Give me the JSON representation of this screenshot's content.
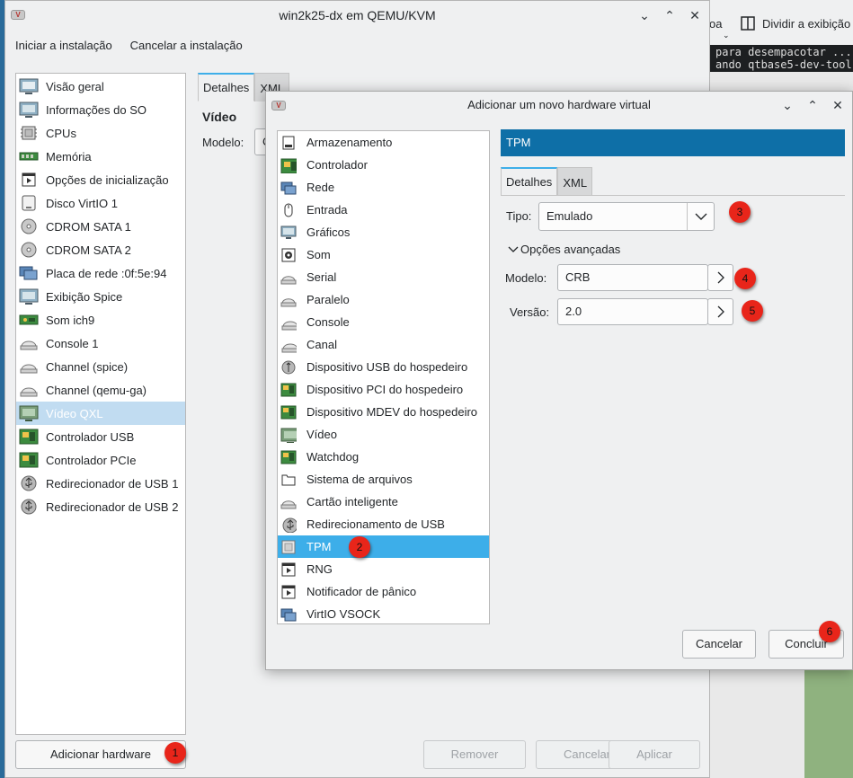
{
  "background": {
    "toolbar_partial_left": "oa",
    "toolbar_split_label": "Dividir a exibição",
    "terminal_lines": [
      "para desempacotar ...",
      "ando qtbase5-dev-tool"
    ]
  },
  "main_window": {
    "title": "win2k25-dx em QEMU/KVM",
    "menu": [
      "Iniciar a instalação",
      "Cancelar a instalação"
    ],
    "hardware_items": [
      {
        "label": "Visão geral",
        "icon": "overview-icon"
      },
      {
        "label": "Informações do SO",
        "icon": "os-info-icon"
      },
      {
        "label": "CPUs",
        "icon": "cpu-icon"
      },
      {
        "label": "Memória",
        "icon": "memory-icon"
      },
      {
        "label": "Opções de inicialização",
        "icon": "boot-options-icon"
      },
      {
        "label": "Disco VirtIO 1",
        "icon": "disk-icon"
      },
      {
        "label": "CDROM SATA 1",
        "icon": "cdrom-icon"
      },
      {
        "label": "CDROM SATA 2",
        "icon": "cdrom-icon"
      },
      {
        "label": "Placa de rede :0f:5e:94",
        "icon": "network-card-icon"
      },
      {
        "label": "Exibição Spice",
        "icon": "display-icon"
      },
      {
        "label": "Som ich9",
        "icon": "sound-card-icon"
      },
      {
        "label": "Console 1",
        "icon": "console-icon"
      },
      {
        "label": "Channel (spice)",
        "icon": "channel-icon"
      },
      {
        "label": "Channel (qemu-ga)",
        "icon": "channel-icon"
      },
      {
        "label": "Vídeo QXL",
        "icon": "video-icon",
        "selected": true
      },
      {
        "label": "Controlador USB",
        "icon": "controller-icon"
      },
      {
        "label": "Controlador PCIe",
        "icon": "controller-icon"
      },
      {
        "label": "Redirecionador de USB 1",
        "icon": "usb-redirect-icon"
      },
      {
        "label": "Redirecionador de USB 2",
        "icon": "usb-redirect-icon"
      }
    ],
    "tabs": [
      "Detalhes",
      "XML"
    ],
    "section_title": "Vídeo",
    "model_label": "Modelo:",
    "model_value_partial": "C",
    "add_hardware_button": "Adicionar hardware",
    "remove_button": "Remover",
    "cancel_button": "Cancelar",
    "apply_button": "Aplicar"
  },
  "dialog": {
    "title": "Adicionar um novo hardware virtual",
    "device_types": [
      {
        "label": "Armazenamento",
        "icon": "storage-icon"
      },
      {
        "label": "Controlador",
        "icon": "controller-icon"
      },
      {
        "label": "Rede",
        "icon": "network-icon"
      },
      {
        "label": "Entrada",
        "icon": "mouse-icon"
      },
      {
        "label": "Gráficos",
        "icon": "graphics-icon"
      },
      {
        "label": "Som",
        "icon": "sound-icon"
      },
      {
        "label": "Serial",
        "icon": "serial-icon"
      },
      {
        "label": "Paralelo",
        "icon": "parallel-icon"
      },
      {
        "label": "Console",
        "icon": "console-icon"
      },
      {
        "label": "Canal",
        "icon": "channel-icon"
      },
      {
        "label": "Dispositivo USB do hospedeiro",
        "icon": "usb-host-icon"
      },
      {
        "label": "Dispositivo PCI do hospedeiro",
        "icon": "pci-host-icon"
      },
      {
        "label": "Dispositivo MDEV do hospedeiro",
        "icon": "mdev-host-icon"
      },
      {
        "label": "Vídeo",
        "icon": "video-icon"
      },
      {
        "label": "Watchdog",
        "icon": "watchdog-icon"
      },
      {
        "label": "Sistema de arquivos",
        "icon": "filesystem-icon"
      },
      {
        "label": "Cartão inteligente",
        "icon": "smartcard-icon"
      },
      {
        "label": "Redirecionamento de USB",
        "icon": "usb-redirect-icon"
      },
      {
        "label": "TPM",
        "icon": "tpm-icon",
        "selected": true
      },
      {
        "label": "RNG",
        "icon": "rng-icon"
      },
      {
        "label": "Notificador de pânico",
        "icon": "panic-notifier-icon"
      },
      {
        "label": "VirtIO VSOCK",
        "icon": "vsock-icon"
      }
    ],
    "section_header": "TPM",
    "tabs": [
      "Detalhes",
      "XML"
    ],
    "type_label": "Tipo:",
    "type_value": "Emulado",
    "advanced_label": "Opções avançadas",
    "model_label": "Modelo:",
    "model_value": "CRB",
    "version_label": "Versão:",
    "version_value": "2.0",
    "cancel_button": "Cancelar",
    "finish_button": "Concluir"
  },
  "step_markers": [
    "1",
    "2",
    "3",
    "4",
    "5",
    "6"
  ],
  "colors": {
    "accent": "#3daee9",
    "header_blue": "#0e6fa7",
    "selection_light": "#c1dcf1",
    "marker_red": "#e8251a"
  }
}
